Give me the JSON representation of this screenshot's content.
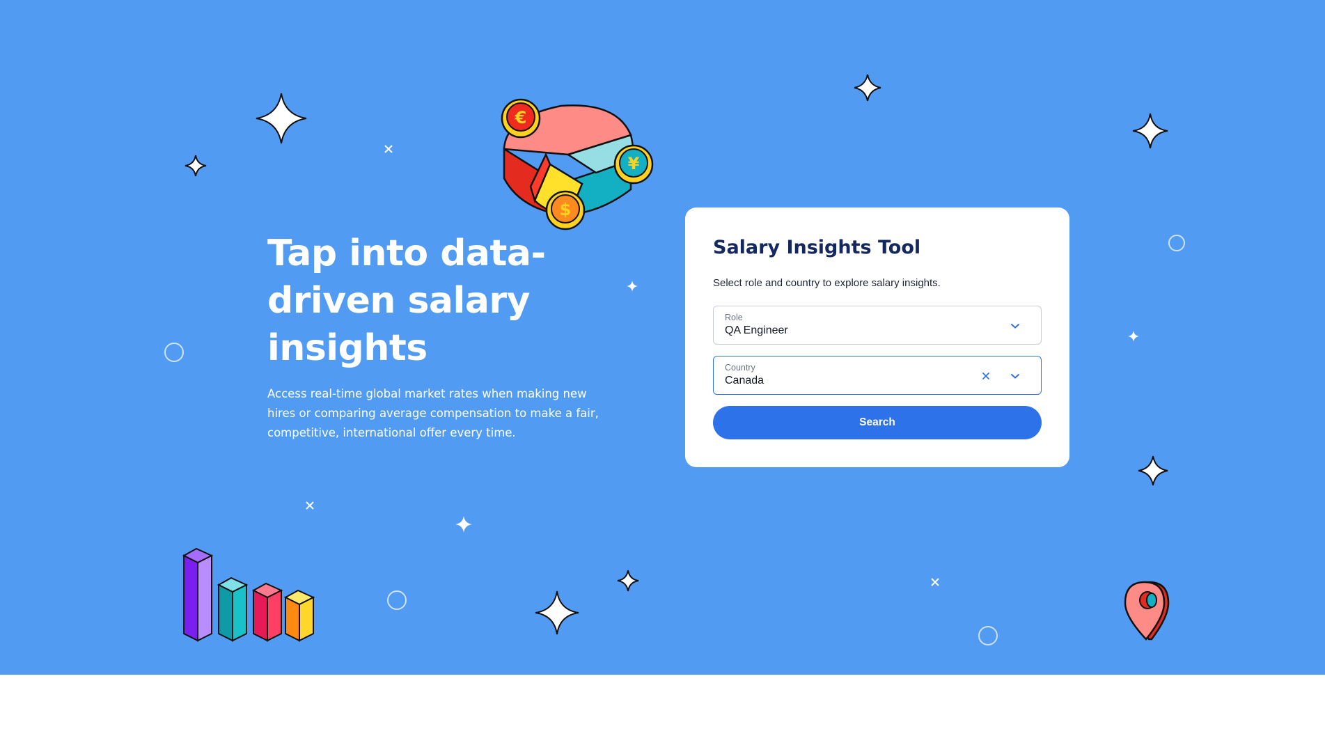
{
  "hero": {
    "headline": "Tap into data-driven salary insights",
    "subtext": "Access real-time global market rates when making new hires or comparing average compensation to make a fair, competitive, international offer every time."
  },
  "card": {
    "title": "Salary Insights Tool",
    "description": "Select role and country to explore salary insights.",
    "role_field": {
      "label": "Role",
      "value": "QA Engineer",
      "icon": "chevron-down-icon"
    },
    "country_field": {
      "label": "Country",
      "value": "Canada",
      "icons": [
        "clear-icon",
        "chevron-down-icon"
      ]
    },
    "search_label": "Search"
  },
  "illustrations": {
    "pie_coins": [
      "€",
      "¥",
      "$"
    ],
    "bar_chart": "3d-bar-chart-illustration",
    "map_pin": "map-pin-icon"
  },
  "colors": {
    "hero_background": "#529bf3",
    "card_title": "#14275e",
    "primary_button": "#2d72e9",
    "focused_border": "#2f74e8"
  }
}
